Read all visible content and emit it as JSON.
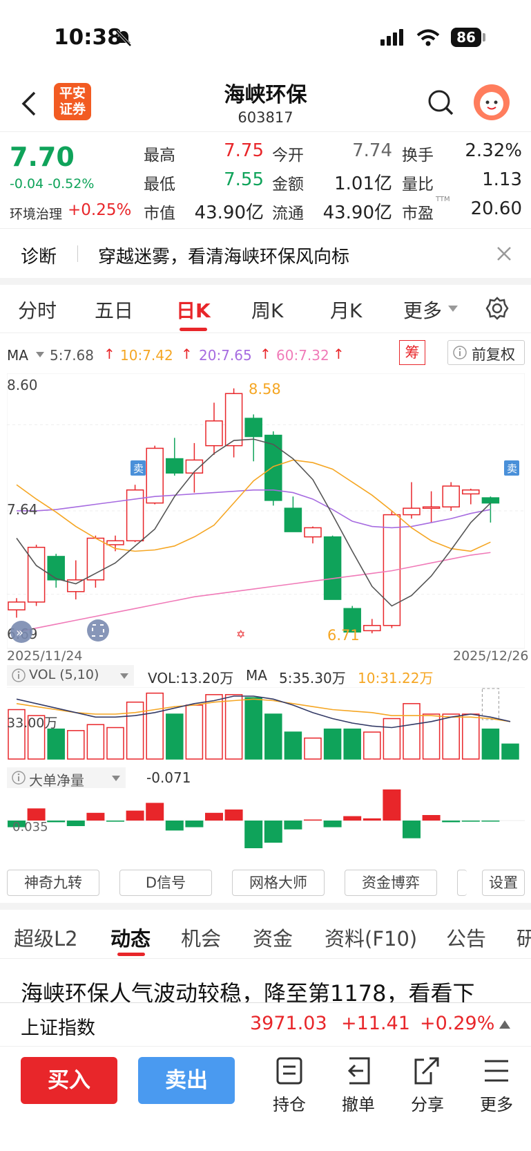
{
  "status": {
    "time": "10:38",
    "battery": "86"
  },
  "header": {
    "title": "海峡环保",
    "code": "603817",
    "broker_logo": "平安证券"
  },
  "quote": {
    "price": "7.70",
    "change": "-0.04 -0.52%",
    "sector": "环境治理",
    "sector_change": "+0.25%",
    "cells": [
      {
        "label": "最高",
        "value": "7.75"
      },
      {
        "label": "今开",
        "value": "7.74"
      },
      {
        "label": "换手",
        "value": "2.32%"
      },
      {
        "label": "最低",
        "value": "7.55"
      },
      {
        "label": "金额",
        "value": "1.01亿"
      },
      {
        "label": "量比",
        "value": "1.13"
      },
      {
        "label": "市值",
        "value": "43.90亿"
      },
      {
        "label": "流通",
        "value": "43.90亿"
      },
      {
        "label": "市盈",
        "value": "20.60",
        "sup": "TTM"
      }
    ]
  },
  "diagnosis": {
    "label": "诊断",
    "text": "穿越迷雾，看清海峡环保风向标"
  },
  "period_tabs": [
    "分时",
    "五日",
    "日K",
    "周K",
    "月K",
    "更多"
  ],
  "ma_row": {
    "label": "MA",
    "items": [
      "5:7.68",
      "10:7.42",
      "20:7.65",
      "60:7.32"
    ],
    "chip": "筹",
    "adjust": "前复权"
  },
  "colors": {
    "up": "#e8262a",
    "down": "#0fa35a",
    "ma5": "#555555",
    "ma10": "#f5a623",
    "ma20": "#a66be0",
    "ma60": "#f07ab8"
  },
  "chart_data": {
    "type": "candlestick",
    "x_range": [
      "2025/11/24",
      "2025/12/26"
    ],
    "y_labels": [
      "8.60",
      "7.64",
      "6.69"
    ],
    "max_label": "8.58",
    "min_label": "6.71",
    "ohlc": [
      [
        6.88,
        6.97,
        6.82,
        6.94
      ],
      [
        6.94,
        7.38,
        6.91,
        7.36
      ],
      [
        7.29,
        7.31,
        7.05,
        7.11
      ],
      [
        7.02,
        7.26,
        6.96,
        7.11
      ],
      [
        7.11,
        7.45,
        7.05,
        7.43
      ],
      [
        7.38,
        7.45,
        7.33,
        7.41
      ],
      [
        7.41,
        7.84,
        7.4,
        7.8
      ],
      [
        7.7,
        8.14,
        7.69,
        8.12
      ],
      [
        8.04,
        8.2,
        7.91,
        7.93
      ],
      [
        7.93,
        8.16,
        7.78,
        8.03
      ],
      [
        8.14,
        8.47,
        8.07,
        8.33
      ],
      [
        8.14,
        8.58,
        8.05,
        8.54
      ],
      [
        8.35,
        8.38,
        8.02,
        8.21
      ],
      [
        8.22,
        8.25,
        7.68,
        7.72
      ],
      [
        7.66,
        7.75,
        7.49,
        7.48
      ],
      [
        7.44,
        7.52,
        7.39,
        7.51
      ],
      [
        7.44,
        7.45,
        6.98,
        6.96
      ],
      [
        6.89,
        6.91,
        6.73,
        6.71
      ],
      [
        6.72,
        6.81,
        6.7,
        6.76
      ],
      [
        6.76,
        7.64,
        6.74,
        7.61
      ],
      [
        7.61,
        7.86,
        7.58,
        7.66
      ],
      [
        7.66,
        7.79,
        7.55,
        7.67
      ],
      [
        7.67,
        7.86,
        7.64,
        7.83
      ],
      [
        7.77,
        7.81,
        7.69,
        7.8
      ],
      [
        7.74,
        7.75,
        7.55,
        7.7
      ]
    ],
    "ma5": [
      7.43,
      7.22,
      7.12,
      7.08,
      7.16,
      7.24,
      7.37,
      7.5,
      7.75,
      7.94,
      8.08,
      8.18,
      8.19,
      8.15,
      8.04,
      7.88,
      7.61,
      7.33,
      7.06,
      6.91,
      6.99,
      7.14,
      7.34,
      7.55,
      7.7
    ],
    "ma10": [
      7.84,
      7.73,
      7.63,
      7.52,
      7.43,
      7.35,
      7.33,
      7.34,
      7.37,
      7.44,
      7.53,
      7.7,
      7.87,
      7.98,
      8.03,
      8.01,
      7.96,
      7.86,
      7.76,
      7.64,
      7.51,
      7.41,
      7.35,
      7.33,
      7.4
    ],
    "ma20": [
      7.64,
      7.64,
      7.65,
      7.67,
      7.69,
      7.71,
      7.73,
      7.75,
      7.76,
      7.77,
      7.78,
      7.79,
      7.8,
      7.8,
      7.78,
      7.73,
      7.65,
      7.56,
      7.52,
      7.51,
      7.52,
      7.55,
      7.58,
      7.62,
      7.65
    ],
    "ma60": [
      6.71,
      6.74,
      6.77,
      6.8,
      6.83,
      6.86,
      6.89,
      6.92,
      6.95,
      6.98,
      7.0,
      7.02,
      7.04,
      7.06,
      7.08,
      7.1,
      7.12,
      7.14,
      7.16,
      7.18,
      7.21,
      7.24,
      7.27,
      7.3,
      7.32
    ]
  },
  "volume": {
    "label": "VOL (5,10)",
    "vol_text": "VOL:13.20万",
    "ma_text": "MA",
    "ma5_text": "5:35.30万",
    "ma10_text": "10:31.22万",
    "y_label": "33.00万",
    "values": [
      33,
      29,
      20,
      19,
      23,
      21,
      38,
      44,
      30,
      36,
      43,
      43,
      41,
      30,
      18,
      14,
      20,
      20,
      18,
      27,
      37,
      30,
      30,
      30,
      20,
      10
    ],
    "ma5": [
      40,
      37,
      34,
      31,
      28,
      28,
      29,
      31,
      34,
      37,
      39,
      42,
      42,
      40,
      36,
      31,
      27,
      24,
      22,
      21,
      23,
      25,
      28,
      30,
      28,
      25
    ],
    "ma10": [
      37,
      35,
      33,
      31,
      30,
      30,
      31,
      33,
      35,
      36,
      38,
      39,
      40,
      39,
      37,
      35,
      33,
      32,
      31,
      29,
      29,
      29,
      28,
      28,
      27,
      25
    ]
  },
  "flow": {
    "label": "大单净量",
    "value": "-0.071",
    "y_label": "0.035",
    "values": [
      -0.012,
      0.022,
      -0.003,
      -0.01,
      0.014,
      -0.002,
      0.018,
      0.032,
      -0.018,
      -0.012,
      0.014,
      0.02,
      -0.05,
      -0.04,
      -0.016,
      0.0,
      -0.012,
      0.008,
      0.004,
      0.06,
      -0.032,
      0.01,
      -0.003,
      -0.002,
      -0.001
    ]
  },
  "tools": [
    "神奇九转",
    "D信号",
    "网格大师",
    "资金博弈",
    "设置"
  ],
  "feed_tabs": [
    "超级L2",
    "动态",
    "机会",
    "资金",
    "资料(F10)",
    "公告",
    "研"
  ],
  "news": {
    "headline": "海峡环保人气波动较稳，降至第1178，看看下"
  },
  "index": {
    "name": "上证指数",
    "value": "3971.03",
    "change": "+11.41",
    "pct": "+0.29%"
  },
  "actions": {
    "buy": "买入",
    "sell": "卖出",
    "hold": "持仓",
    "cancel": "撤单",
    "share": "分享",
    "more": "更多"
  }
}
